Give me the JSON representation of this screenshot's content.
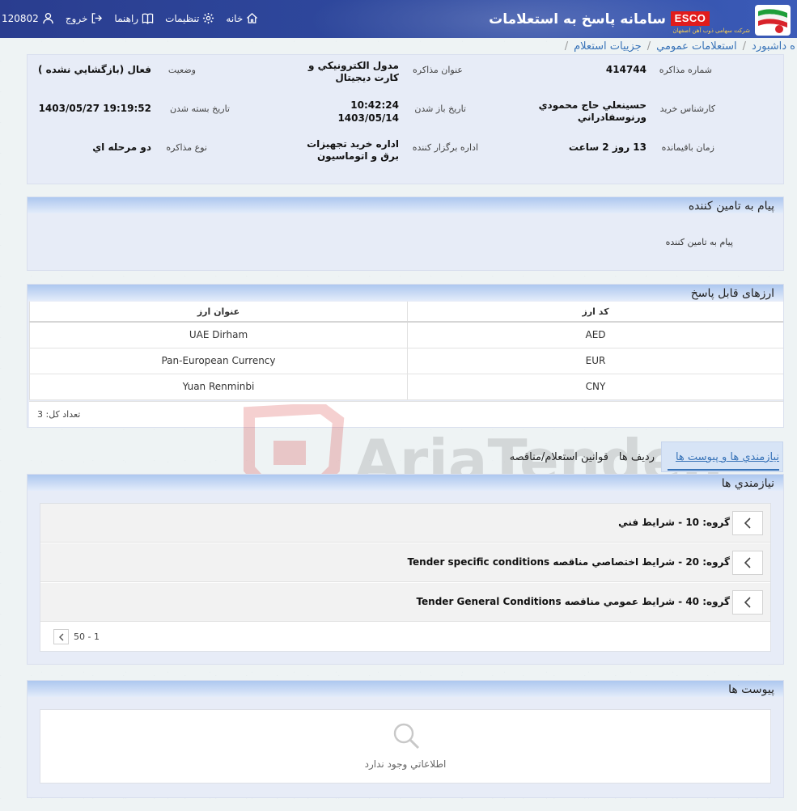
{
  "header": {
    "site_title": "سامانه پاسخ به استعلامات",
    "logo_text": "ESCO",
    "logo_sub": "شرکت سهامی ذوب آهن اصفهان",
    "nav": {
      "home": "خانه",
      "settings": "تنظيمات",
      "help": "راهنما",
      "logout": "خروج",
      "user_id": "120802"
    }
  },
  "breadcrumb": [
    "ه داشبورد",
    "استعلامات عمومي",
    "جزييات استعلام"
  ],
  "info": {
    "inquiry_number_label": "شماره مذاکره",
    "inquiry_number": "414744",
    "inquiry_title_label": "عنوان مذاکره",
    "inquiry_title": "مدول الكترونيكي و كارت ديجيتال",
    "status_label": "وضعيت",
    "status": "فعال (بازگشايي نشده )",
    "expert_label": "کارشناس خريد",
    "expert": "حسينعلي حاج محمودي ورنوسفادراني",
    "open_date_label": "تاريخ باز شدن",
    "open_time": "10:42:24",
    "open_date": "1403/05/14",
    "close_date_label": "تاريخ بسته شدن",
    "close_date": "1403/05/27 19:19:52",
    "remaining_label": "زمان باقيمانده",
    "remaining": "13 روز 2 ساعت",
    "organizer_label": "اداره برگزار کننده",
    "organizer": "اداره خريد تجهيزات برق و اتوماسيون",
    "type_label": "نوع مذاکره",
    "type": "دو مرحله اي"
  },
  "supplier_message": {
    "title": "پيام به تامين كننده",
    "body": "پيام به تامين كننده"
  },
  "currencies": {
    "title": "ارزهای قابل پاسخ",
    "columns": [
      "کد ارز",
      "عنوان ارز"
    ],
    "rows": [
      {
        "code": "AED",
        "name": "UAE Dirham"
      },
      {
        "code": "EUR",
        "name": "Pan-European Currency"
      },
      {
        "code": "CNY",
        "name": "Yuan Renminbi"
      }
    ],
    "total": "تعداد کل: 3"
  },
  "tabs": [
    "نيازمندي ها و پيوست ها",
    "رديف ها",
    "قوانين استعلام/مناقصه"
  ],
  "requirements": {
    "title": "نيازمندي ها",
    "groups": [
      {
        "label": "گروه: 10 - شرايط فني"
      },
      {
        "label": "گروه: 20 - شرايط اختصاصي مناقصه Tender specific conditions"
      },
      {
        "label": "گروه: 40 - شرايط عمومي مناقصه Tender General Conditions"
      }
    ],
    "pager": "1 - 50"
  },
  "attachments": {
    "title": "پيوست ها",
    "empty": "اطلاعاتي وجود ندارد"
  },
  "watermark": "AriaTender.neT",
  "colors": {
    "header": "#2f4aa0",
    "link": "#3873b8",
    "panel": "#e7ecf7",
    "esco_red": "#e11c1c"
  }
}
